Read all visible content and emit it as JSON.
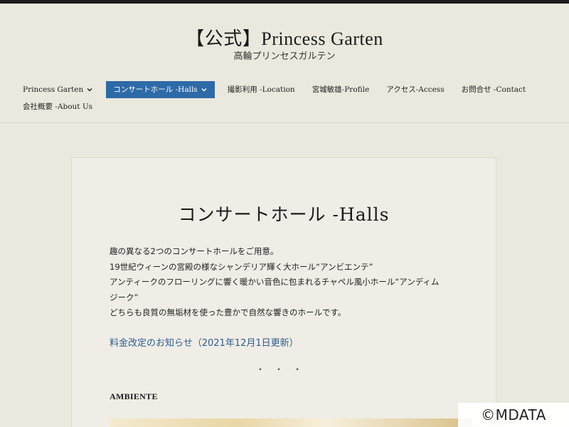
{
  "header": {
    "title": "【公式】Princess Garten",
    "subtitle": "高輪プリンセスガルテン"
  },
  "nav": {
    "items": [
      {
        "label": "Princess Garten",
        "has_dropdown": true,
        "active": false
      },
      {
        "label": "コンサートホール -Halls",
        "has_dropdown": true,
        "active": true
      },
      {
        "label": "撮影利用 -Location",
        "has_dropdown": false,
        "active": false
      },
      {
        "label": "宮城敏雄-Profile",
        "has_dropdown": false,
        "active": false
      },
      {
        "label": "アクセス-Access",
        "has_dropdown": false,
        "active": false
      },
      {
        "label": "お問合せ -Contact",
        "has_dropdown": false,
        "active": false
      },
      {
        "label": "会社概要 -About Us",
        "has_dropdown": false,
        "active": false
      }
    ],
    "active_color": "#2d6aa8"
  },
  "content": {
    "title": "コンサートホール -Halls",
    "paragraph_lines": [
      "趣の異なる2つのコンサートホールをご用意。",
      "19世紀ウィーンの宮殿の様なシャンデリア輝く大ホール“アンビエンテ”",
      "アンティークのフローリングに響く暖かい音色に包まれるチャペル風小ホール“アンディム",
      "ジーク”",
      "どちらも良質の無垢材を使った豊かで自然な響きのホールです。"
    ],
    "notice_link": "料金改定のお知らせ（2021年12月1日更新）",
    "separator": "・・・",
    "section_heading": "AMBIENTE"
  },
  "watermark": "©MDATA",
  "colors": {
    "background": "#ebe8de",
    "card": "#efede6",
    "link": "#2d5c8e"
  }
}
